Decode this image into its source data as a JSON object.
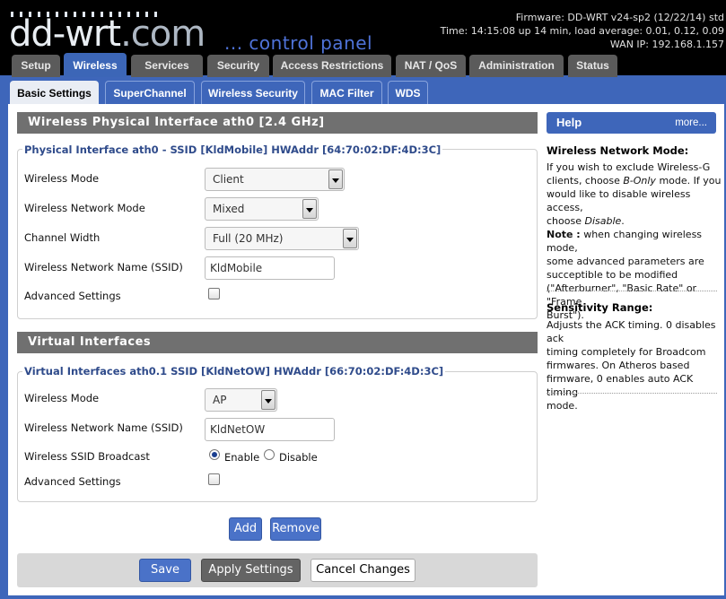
{
  "header": {
    "logo_main": "dd-wrt",
    "logo_suffix": ".com",
    "subtitle": "... control panel",
    "firmware": "Firmware: DD-WRT v24-sp2 (12/22/14) std",
    "time": "Time: 14:15:08 up 14 min, load average: 0.01, 0.12, 0.09",
    "wan_ip": "WAN IP: 192.168.1.157"
  },
  "main_tabs": [
    "Setup",
    "Wireless",
    "Services",
    "Security",
    "Access Restrictions",
    "NAT / QoS",
    "Administration",
    "Status"
  ],
  "sub_tabs": [
    "Basic Settings",
    "SuperChannel",
    "Wireless Security",
    "MAC Filter",
    "WDS"
  ],
  "physical": {
    "section_title": "Wireless Physical Interface ath0 [2.4 GHz]",
    "legend": "Physical Interface ath0 - SSID [KldMobile] HWAddr [64:70:02:DF:4D:3C]",
    "wireless_mode_label": "Wireless Mode",
    "wireless_mode_value": "Client",
    "network_mode_label": "Wireless Network Mode",
    "network_mode_value": "Mixed",
    "channel_width_label": "Channel Width",
    "channel_width_value": "Full (20 MHz)",
    "ssid_label": "Wireless Network Name (SSID)",
    "ssid_value": "KldMobile",
    "advanced_label": "Advanced Settings"
  },
  "virtual": {
    "section_title": "Virtual Interfaces",
    "legend": "Virtual Interfaces ath0.1 SSID [KldNetOW] HWAddr [66:70:02:DF:4D:3C]",
    "wireless_mode_label": "Wireless Mode",
    "wireless_mode_value": "AP",
    "ssid_label": "Wireless Network Name (SSID)",
    "ssid_value": "KldNetOW",
    "broadcast_label": "Wireless SSID Broadcast",
    "enable_label": "Enable",
    "disable_label": "Disable",
    "advanced_label": "Advanced Settings",
    "add_label": "Add",
    "remove_label": "Remove"
  },
  "footer_buttons": {
    "save": "Save",
    "apply": "Apply Settings",
    "cancel": "Cancel Changes"
  },
  "help": {
    "title": "Help",
    "more": "more...",
    "mode_title": "Wireless Network Mode:",
    "mode_line1": "If you wish to exclude Wireless-G",
    "mode_line2a": "clients, choose ",
    "mode_line2b": "B-Only",
    "mode_line2c": " mode. If you",
    "mode_line3": "would like to disable wireless access,",
    "mode_line4a": "choose ",
    "mode_line4b": "Disable",
    "mode_line4c": ".",
    "note_label": "Note :",
    "note_line1": " when changing wireless mode,",
    "note_line2": "some advanced parameters are",
    "note_line3": "succeptible to be modified",
    "note_line4": "(\"Afterburner\", \"Basic Rate\" or \"Frame",
    "note_line5": "Burst\").",
    "sens_title": "Sensitivity Range:",
    "sens_line1": "Adjusts the ACK timing. 0 disables ack",
    "sens_line2": "timing completely for Broadcom",
    "sens_line3": "firmwares. On Atheros based",
    "sens_line4": "firmware, 0 enables auto ACK timing",
    "sens_line5": "mode."
  }
}
